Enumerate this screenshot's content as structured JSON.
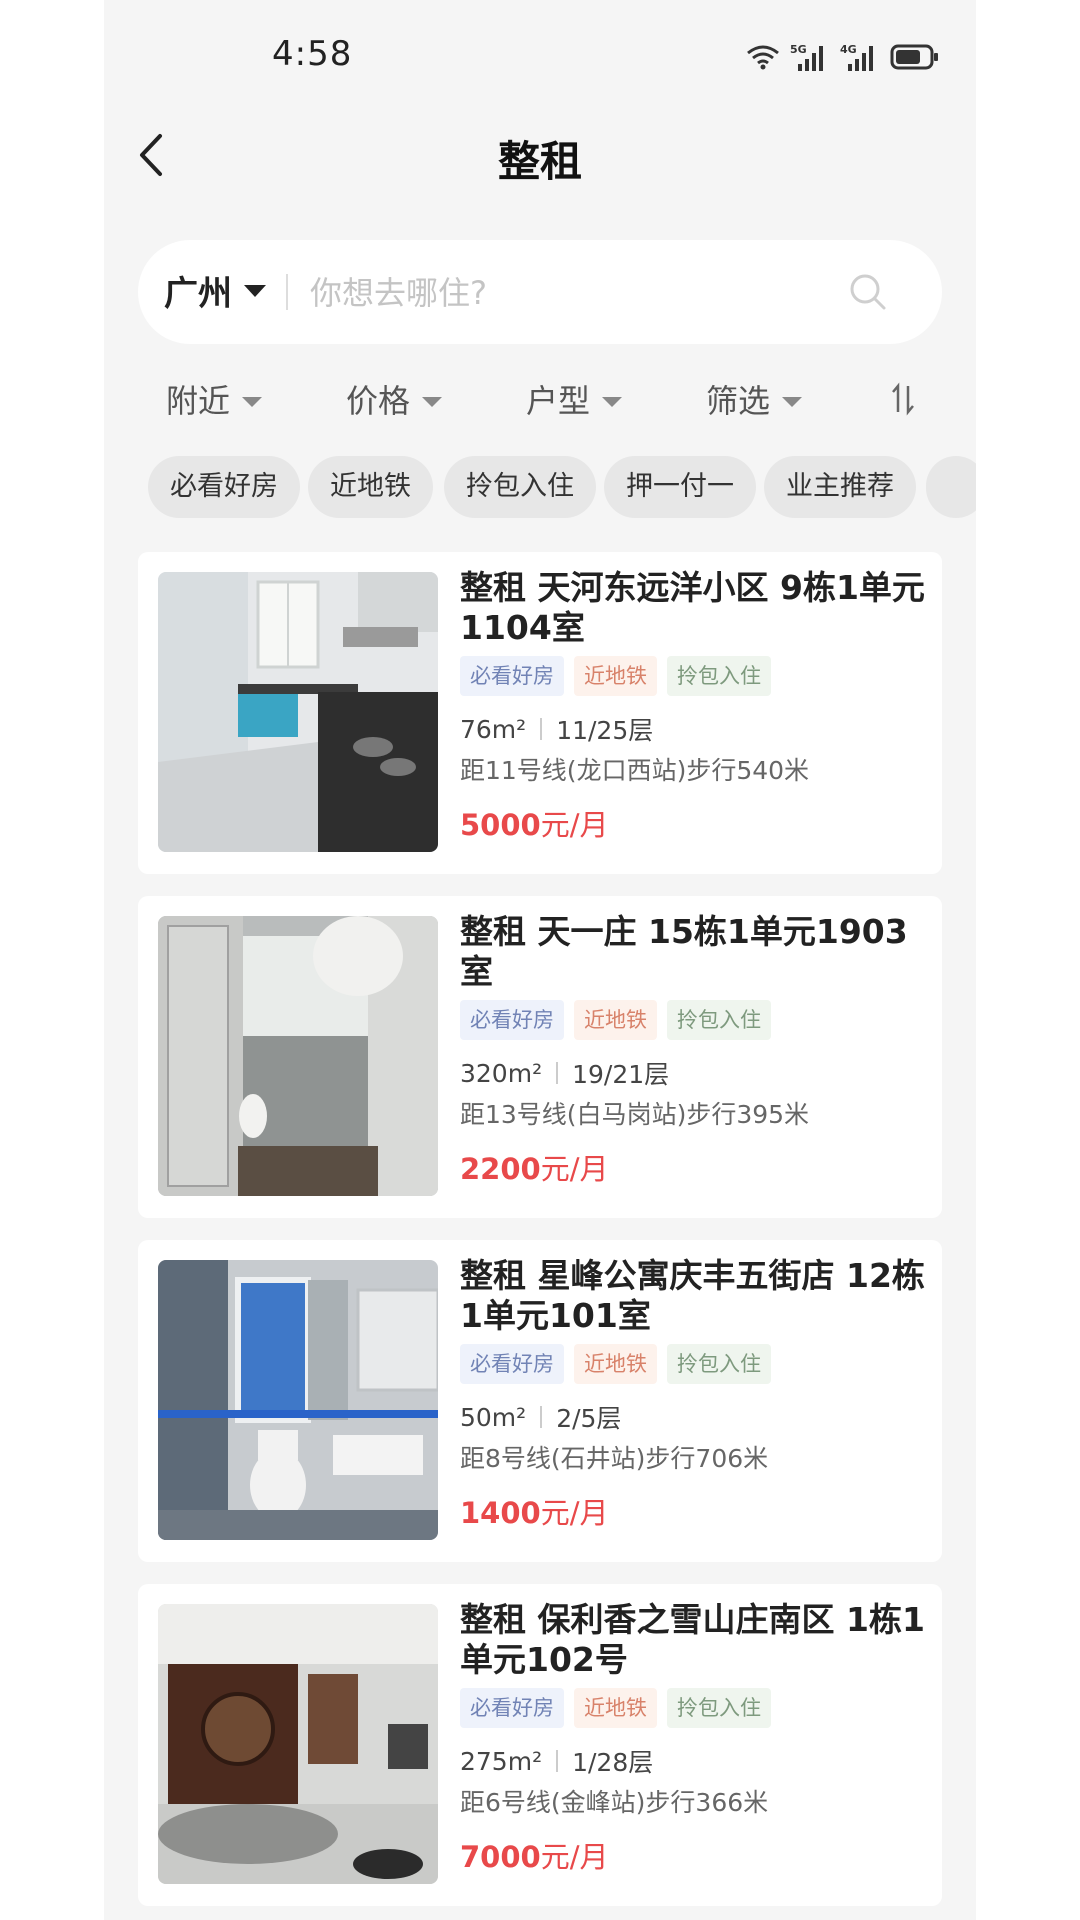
{
  "status": {
    "time": "4:58",
    "net1": "5G",
    "net2": "4G"
  },
  "nav": {
    "title": "整租"
  },
  "search": {
    "city": "广州",
    "placeholder": "你想去哪住?"
  },
  "filters": [
    "附近",
    "价格",
    "户型",
    "筛选"
  ],
  "chips": [
    "必看好房",
    "近地铁",
    "拎包入住",
    "押一付一",
    "业主推荐"
  ],
  "listings": [
    {
      "title": "整租 天河东远洋小区 9栋1单元1104室",
      "tags": [
        "必看好房",
        "近地铁",
        "拎包入住"
      ],
      "area": "76m²",
      "floor": "11/25层",
      "distance": "距11号线(龙口西站)步行540米",
      "price": "5000",
      "unit": "元/月"
    },
    {
      "title": "整租 天一庄 15栋1单元1903室",
      "tags": [
        "必看好房",
        "近地铁",
        "拎包入住"
      ],
      "area": "320m²",
      "floor": "19/21层",
      "distance": "距13号线(白马岗站)步行395米",
      "price": "2200",
      "unit": "元/月"
    },
    {
      "title": "整租 星峰公寓庆丰五街店 12栋1单元101室",
      "tags": [
        "必看好房",
        "近地铁",
        "拎包入住"
      ],
      "area": "50m²",
      "floor": "2/5层",
      "distance": "距8号线(石井站)步行706米",
      "price": "1400",
      "unit": "元/月"
    },
    {
      "title": "整租 保利香之雪山庄南区 1栋1单元102号",
      "tags": [
        "必看好房",
        "近地铁",
        "拎包入住"
      ],
      "area": "275m²",
      "floor": "1/28层",
      "distance": "距6号线(金峰站)步行366米",
      "price": "7000",
      "unit": "元/月"
    }
  ],
  "colors": {
    "price": "#e8494a",
    "background": "#f5f5f5"
  }
}
